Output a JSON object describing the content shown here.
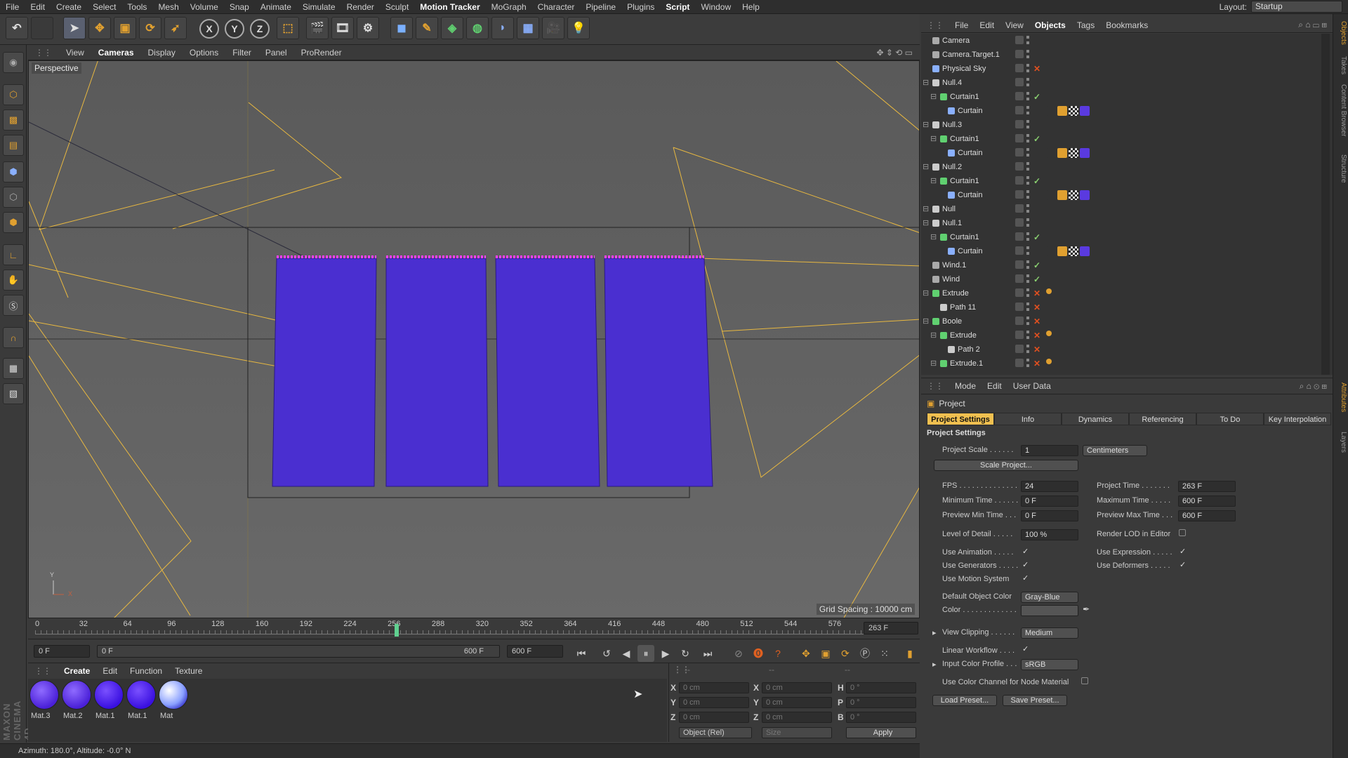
{
  "menubar": {
    "items": [
      "File",
      "Edit",
      "Create",
      "Select",
      "Tools",
      "Mesh",
      "Volume",
      "Snap",
      "Animate",
      "Simulate",
      "Render",
      "Sculpt",
      "Motion Tracker",
      "MoGraph",
      "Character",
      "Pipeline",
      "Plugins",
      "Script",
      "Window",
      "Help"
    ],
    "layout_label": "Layout:",
    "layout_value": "Startup"
  },
  "viewport": {
    "menu": [
      "View",
      "Cameras",
      "Display",
      "Options",
      "Filter",
      "Panel",
      "ProRender"
    ],
    "label": "Perspective",
    "grid_spacing": "Grid Spacing : 10000 cm",
    "axis_y": "Y",
    "axis_x": "X"
  },
  "timeline": {
    "ticks": [
      "0",
      "32",
      "64",
      "96",
      "128",
      "160",
      "192",
      "224",
      "256",
      "288",
      "320",
      "352",
      "364",
      "416",
      "448",
      "480",
      "512",
      "544",
      "576"
    ],
    "current_frame": "263 F",
    "start_field": "0 F",
    "range_start": "0 F",
    "range_end": "600 F",
    "end_field": "600 F"
  },
  "materials": {
    "menu": [
      "Create",
      "Edit",
      "Function",
      "Texture"
    ],
    "items": [
      "Mat.3",
      "Mat.2",
      "Mat.1",
      "Mat.1",
      "Mat"
    ]
  },
  "coords": {
    "header": [
      "--",
      "--",
      "--"
    ],
    "rows": [
      {
        "a": "X",
        "av": "0 cm",
        "b": "X",
        "bv": "0 cm",
        "c": "H",
        "cv": "0 °"
      },
      {
        "a": "Y",
        "av": "0 cm",
        "b": "Y",
        "bv": "0 cm",
        "c": "P",
        "cv": "0 °"
      },
      {
        "a": "Z",
        "av": "0 cm",
        "b": "Z",
        "bv": "0 cm",
        "c": "B",
        "cv": "0 °"
      }
    ],
    "mode": "Object (Rel)",
    "size": "Size",
    "apply": "Apply"
  },
  "status": "Azimuth: 180.0°, Altitude: -0.0°  N",
  "objects": {
    "menu": [
      "File",
      "Edit",
      "View",
      "Objects",
      "Tags",
      "Bookmarks"
    ],
    "rows": [
      {
        "name": "Camera",
        "indent": 0,
        "flag": ""
      },
      {
        "name": "Camera.Target.1",
        "indent": 0,
        "flag": ""
      },
      {
        "name": "Physical Sky",
        "indent": 0,
        "flag": "✕"
      },
      {
        "name": "Null.4",
        "indent": 0,
        "flag": ""
      },
      {
        "name": "Curtain1",
        "indent": 1,
        "flag": "✓"
      },
      {
        "name": "Curtain",
        "indent": 2,
        "flag": ""
      },
      {
        "name": "Null.3",
        "indent": 0,
        "flag": ""
      },
      {
        "name": "Curtain1",
        "indent": 1,
        "flag": "✓"
      },
      {
        "name": "Curtain",
        "indent": 2,
        "flag": ""
      },
      {
        "name": "Null.2",
        "indent": 0,
        "flag": ""
      },
      {
        "name": "Curtain1",
        "indent": 1,
        "flag": "✓"
      },
      {
        "name": "Curtain",
        "indent": 2,
        "flag": ""
      },
      {
        "name": "Null",
        "indent": 0,
        "flag": ""
      },
      {
        "name": "Null.1",
        "indent": 0,
        "flag": ""
      },
      {
        "name": "Curtain1",
        "indent": 1,
        "flag": "✓"
      },
      {
        "name": "Curtain",
        "indent": 2,
        "flag": ""
      },
      {
        "name": "Wind.1",
        "indent": 0,
        "flag": "✓"
      },
      {
        "name": "Wind",
        "indent": 0,
        "flag": "✓"
      },
      {
        "name": "Extrude",
        "indent": 0,
        "flag": "✕"
      },
      {
        "name": "Path 11",
        "indent": 1,
        "flag": "✕"
      },
      {
        "name": "Boole",
        "indent": 0,
        "flag": "✕"
      },
      {
        "name": "Extrude",
        "indent": 1,
        "flag": "✕"
      },
      {
        "name": "Path 2",
        "indent": 2,
        "flag": "✕"
      },
      {
        "name": "Extrude.1",
        "indent": 1,
        "flag": "✕"
      }
    ]
  },
  "attributes": {
    "menu": [
      "Mode",
      "Edit",
      "User Data"
    ],
    "title": "Project",
    "tabs": [
      "Project Settings",
      "Info",
      "Dynamics",
      "Referencing",
      "To Do",
      "Key Interpolation"
    ],
    "section": "Project Settings",
    "project_scale_label": "Project Scale . . . . . .",
    "project_scale": "1",
    "scale_unit": "Centimeters",
    "scale_project": "Scale Project...",
    "fps_label": "FPS . . . . . . . . . . . . . .",
    "fps": "24",
    "project_time_label": "Project Time . . . . . . .",
    "project_time": "263 F",
    "min_time_label": "Minimum Time . . . . . .",
    "min_time": "0 F",
    "max_time_label": "Maximum Time . . . . .",
    "max_time": "600 F",
    "prev_min_label": "Preview Min Time . . .",
    "prev_min": "0 F",
    "prev_max_label": "Preview Max Time . . .",
    "prev_max": "600 F",
    "lod_label": "Level of Detail . . . . .",
    "lod": "100 %",
    "render_lod_label": "Render LOD in Editor",
    "use_anim_label": "Use Animation . . . . .",
    "use_expr_label": "Use Expression . . . . .",
    "use_gen_label": "Use Generators . . . . .",
    "use_def_label": "Use Deformers . . . . .",
    "use_motion_label": "Use Motion System",
    "def_color_label": "Default Object Color",
    "def_color": "Gray-Blue",
    "color_label": "Color . . . . . . . . . . . . .",
    "clip_label": "View Clipping . . . . . .",
    "clip": "Medium",
    "linear_label": "Linear Workflow . . . .",
    "icp_label": "Input Color Profile . . .",
    "icp": "sRGB",
    "node_mat_label": "Use Color Channel for Node Material",
    "load_preset": "Load Preset...",
    "save_preset": "Save Preset..."
  },
  "side_tabs": [
    "Objects",
    "Takes",
    "Content Browser",
    "Structure",
    "Attributes",
    "Layers"
  ],
  "colors": {
    "accent": "#f0c050",
    "curtain": "#4a2fd0",
    "rail": "#ff40ff",
    "camera_line": "#e8b840"
  }
}
